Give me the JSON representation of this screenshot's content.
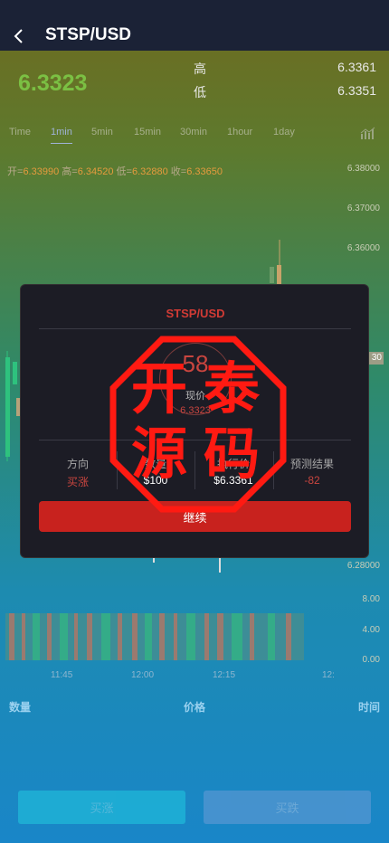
{
  "header": {
    "title": "STSP/USD",
    "back_icon": "chevron-left-icon"
  },
  "quote": {
    "price": "6.3323",
    "high_label": "高",
    "high_value": "6.3361",
    "low_label": "低",
    "low_value": "6.3351"
  },
  "tabs": [
    "Time",
    "1min",
    "5min",
    "15min",
    "30min",
    "1hour",
    "1day"
  ],
  "active_tab": "1min",
  "ohlc": {
    "open_label": "开=",
    "open": "6.33990",
    "high_label": "高=",
    "high": "6.34520",
    "low_label": "低=",
    "low": "6.32880",
    "close_label": "收=",
    "close": "6.33650"
  },
  "chart_data": {
    "type": "candlestick",
    "y_ticks": [
      "6.38000",
      "6.37000",
      "6.36000",
      "6.28000"
    ],
    "volume_ticks": [
      "8.00",
      "4.00",
      "0.00"
    ],
    "x_ticks": [
      "11:45",
      "12:00",
      "12:15",
      "12:"
    ],
    "price_tag": "30"
  },
  "columns": {
    "quantity": "数量",
    "price": "价格",
    "time": "时间"
  },
  "actions": {
    "buy": "买涨",
    "sell": "买跌"
  },
  "modal": {
    "title": "STSP/USD",
    "countdown": "58",
    "now_label": "现价",
    "now_value": "6.3323",
    "info": [
      {
        "label": "方向",
        "value": "买涨"
      },
      {
        "label": "数量",
        "value": "$100"
      },
      {
        "label": "执行价",
        "value": "$6.3361"
      },
      {
        "label": "预测结果",
        "value": "-82"
      }
    ],
    "continue_label": "继续"
  },
  "watermark": {
    "chars": [
      "开",
      "泰",
      "源",
      "码"
    ],
    "color": "#ff1a12"
  },
  "colors": {
    "up": "#2ec27e",
    "down": "#c9453f",
    "accent": "#c8221e",
    "price": "#7bc043"
  }
}
